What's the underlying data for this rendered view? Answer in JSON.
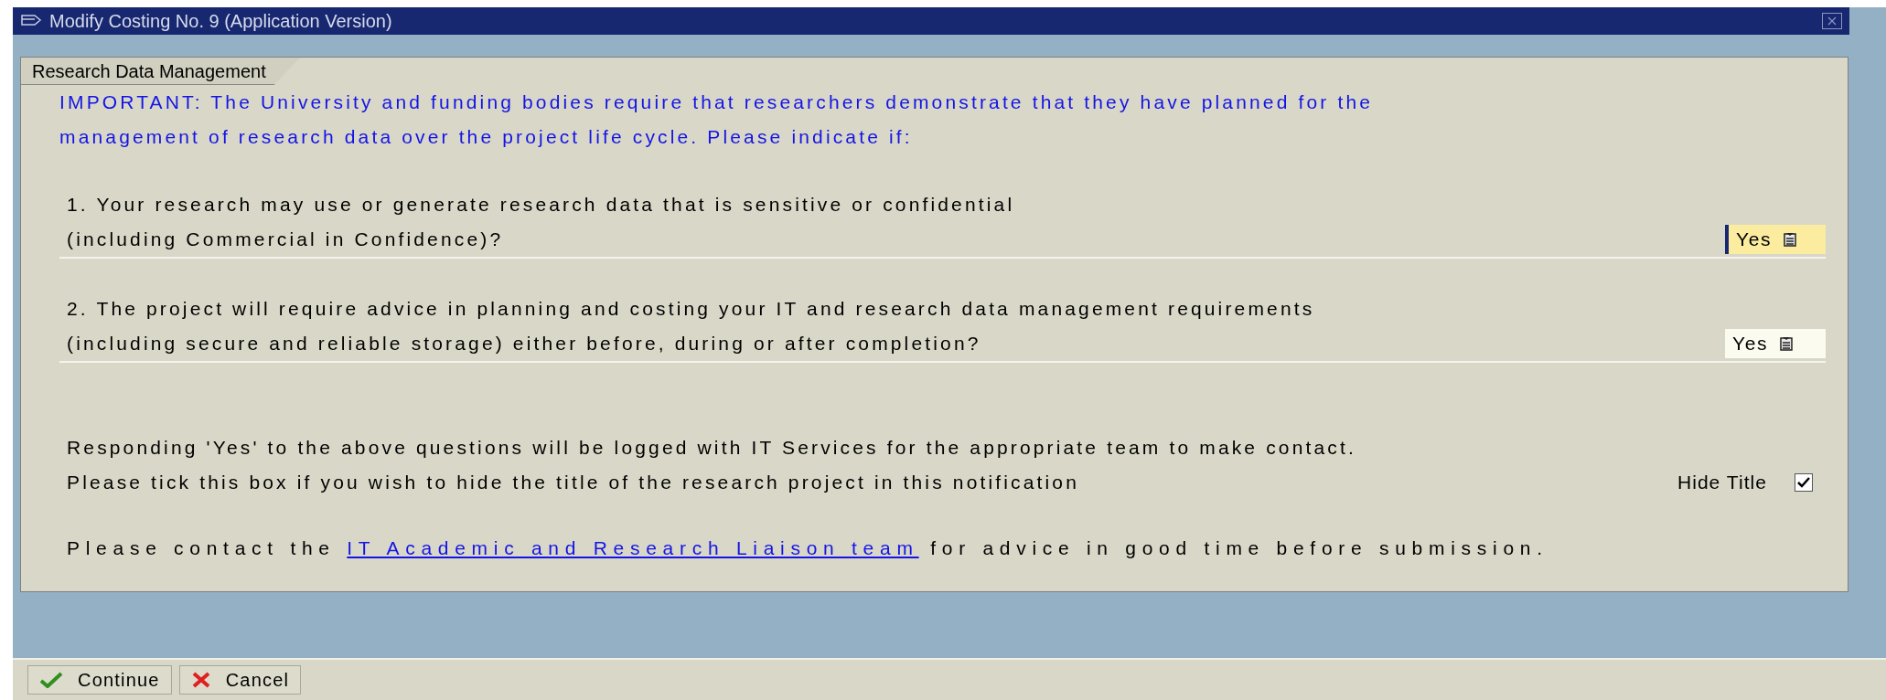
{
  "window": {
    "title": "Modify Costing No. 9 (Application Version)"
  },
  "tab": {
    "label": "Research Data Management"
  },
  "intro": [
    "IMPORTANT: The University and funding bodies require that researchers demonstrate that they have planned for the",
    "management of research data over the project life cycle. Please indicate if:"
  ],
  "questions": [
    {
      "lines": [
        "1. Your research may use or generate research data that is sensitive or confidential",
        "(including Commercial in Confidence)?"
      ],
      "value": "Yes",
      "focused": true
    },
    {
      "lines": [
        "2. The project will require advice in planning and costing your IT and research data management requirements",
        "(including secure and reliable storage) either before, during or after completion?"
      ],
      "value": "Yes",
      "focused": false
    }
  ],
  "notice": [
    "Responding 'Yes' to the above questions will be logged with IT Services for the appropriate team to make contact.",
    "Please tick this box if you wish to hide the title of the research project in this notification"
  ],
  "hide_title": {
    "label": "Hide Title",
    "checked": true
  },
  "contact": {
    "before": "Please contact the",
    "link": "IT Academic and Research Liaison team",
    "after": "for advice in good time before submission."
  },
  "buttons": [
    {
      "kind": "continue",
      "label": "Continue"
    },
    {
      "kind": "cancel",
      "label": "Cancel"
    }
  ]
}
